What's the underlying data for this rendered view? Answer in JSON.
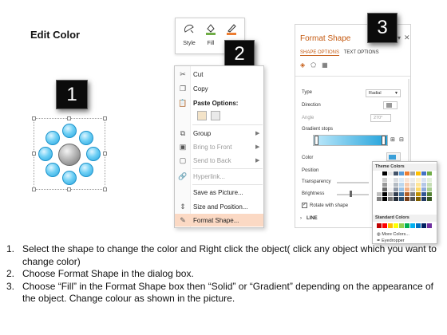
{
  "title": "Edit Color",
  "badges": [
    "1",
    "2",
    "3"
  ],
  "mini_toolbar": {
    "buttons": [
      {
        "label": "Style",
        "icon": "style-icon"
      },
      {
        "label": "Fill",
        "icon": "paint-bucket-icon"
      },
      {
        "label": "O",
        "icon": "pen-outline-icon"
      }
    ]
  },
  "context_menu": {
    "items": [
      {
        "label": "Cut",
        "icon": "scissors-icon",
        "enabled": true
      },
      {
        "label": "Copy",
        "icon": "copy-icon",
        "enabled": true
      },
      {
        "label": "Paste Options:",
        "icon": "paste-icon",
        "enabled": true
      },
      {
        "label": "Group",
        "icon": "group-icon",
        "enabled": true,
        "submenu": true
      },
      {
        "label": "Bring to Front",
        "icon": "bring-front-icon",
        "enabled": false,
        "submenu": true
      },
      {
        "label": "Send to Back",
        "icon": "send-back-icon",
        "enabled": false,
        "submenu": true
      },
      {
        "label": "Hyperlink...",
        "icon": "hyperlink-icon",
        "enabled": false
      },
      {
        "label": "Save as Picture...",
        "icon": "",
        "enabled": true
      },
      {
        "label": "Size and Position...",
        "icon": "size-icon",
        "enabled": true
      },
      {
        "label": "Format Shape...",
        "icon": "format-shape-icon",
        "enabled": true,
        "highlighted": true
      }
    ]
  },
  "format_pane": {
    "title": "Format Shape",
    "tabs": [
      "SHAPE OPTIONS",
      "TEXT OPTIONS"
    ],
    "active_tab": "SHAPE OPTIONS",
    "rows": {
      "type_label": "Type",
      "type_value": "Radial",
      "direction_label": "Direction",
      "angle_label": "Angle",
      "angle_value": "270°",
      "gradient_stops_label": "Gradient stops",
      "color_label": "Color",
      "position_label": "Position",
      "transparency_label": "Transparency",
      "brightness_label": "Brightness",
      "rotate_label": "Rotate with shape",
      "line_label": "LINE"
    }
  },
  "color_popup": {
    "theme_header": "Theme Colors",
    "standard_header": "Standard Colors",
    "more_colors": "More Colors...",
    "eyedropper": "Eyedropper",
    "theme_columns": [
      "#ffffff",
      "#000000",
      "#e7e6e6",
      "#44546a",
      "#5b9bd5",
      "#ed7d31",
      "#a5a5a5",
      "#ffc000",
      "#4472c4",
      "#70ad47"
    ],
    "standard": [
      "#c00000",
      "#ff0000",
      "#ffc000",
      "#ffff00",
      "#92d050",
      "#00b050",
      "#00b0f0",
      "#0070c0",
      "#002060",
      "#7030a0"
    ]
  },
  "instructions": [
    {
      "num": "1.",
      "text": "Select the shape to change the color and Right click the object( click any object which you want to change color)"
    },
    {
      "num": "2.",
      "text": "Choose Format Shape in the dialog box."
    },
    {
      "num": "3.",
      "text": "Choose “Fill” in the Format Shape box then “Solid” or “Gradient” depending on the appearance of the object. Change colour as shown in the picture."
    }
  ]
}
